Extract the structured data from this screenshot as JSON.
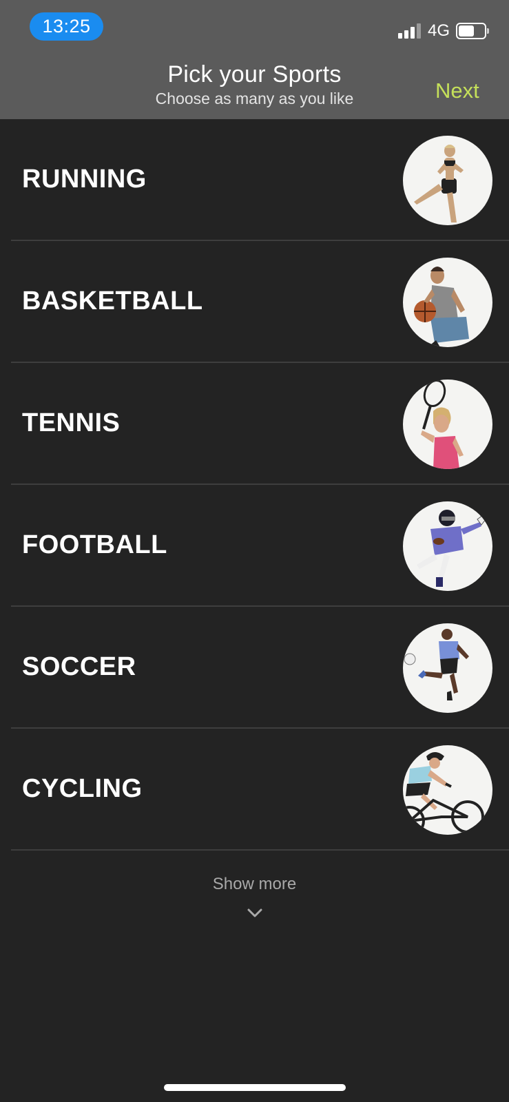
{
  "status_bar": {
    "time": "13:25",
    "network": "4G"
  },
  "header": {
    "title": "Pick your Sports",
    "subtitle": "Choose as many as you like",
    "next_label": "Next"
  },
  "sports": [
    {
      "label": "RUNNING"
    },
    {
      "label": "BASKETBALL"
    },
    {
      "label": "TENNIS"
    },
    {
      "label": "FOOTBALL"
    },
    {
      "label": "SOCCER"
    },
    {
      "label": "CYCLING"
    }
  ],
  "footer": {
    "show_more_label": "Show more"
  },
  "colors": {
    "background": "#232323",
    "header": "#5b5b5b",
    "accent": "#c5e05a",
    "time_pill": "#1a8cf0"
  }
}
